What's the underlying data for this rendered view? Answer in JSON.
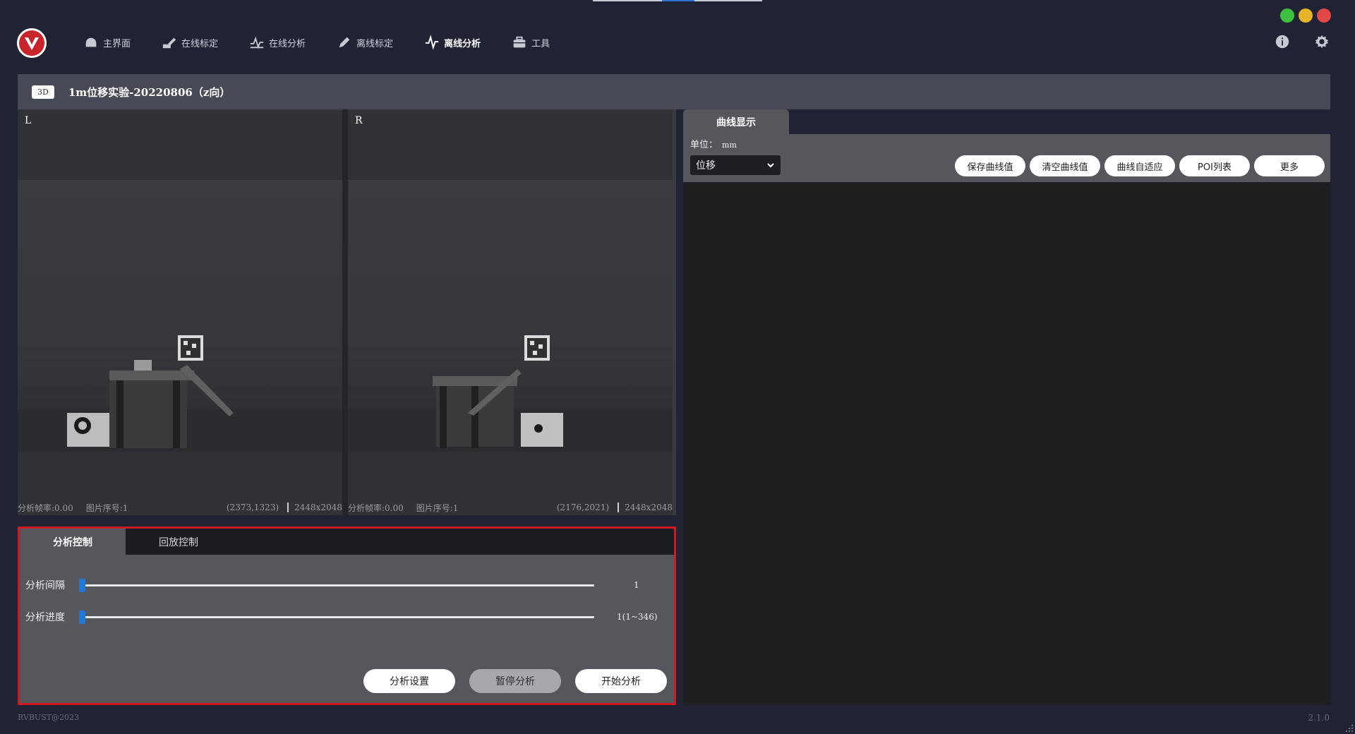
{
  "window": {
    "controls": [
      "green",
      "yellow",
      "red"
    ],
    "colors": {
      "green": "#3fbf3f",
      "yellow": "#e8b52a",
      "red": "#e04848"
    }
  },
  "nav": {
    "items": [
      {
        "label": "主界面",
        "icon": "home-icon"
      },
      {
        "label": "在线标定",
        "icon": "calibrate-pen-icon"
      },
      {
        "label": "在线分析",
        "icon": "analysis-icon"
      },
      {
        "label": "离线标定",
        "icon": "pen-icon"
      },
      {
        "label": "离线分析",
        "icon": "waveform-icon",
        "active": true
      },
      {
        "label": "工具",
        "icon": "toolbox-icon"
      }
    ],
    "right_icons": [
      "info-icon",
      "settings-icon"
    ]
  },
  "project": {
    "badge": "3D",
    "title": "1m位移实验-20220806（z向）"
  },
  "cameras": [
    {
      "label": "L",
      "fps_text": "分析帧率:0.00",
      "frame_text": "图片序号:1",
      "coord": "(2373,1323)",
      "resolution": "2448x2048"
    },
    {
      "label": "R",
      "fps_text": "分析帧率:0.00",
      "frame_text": "图片序号:1",
      "coord": "(2176,2021)",
      "resolution": "2448x2048"
    }
  ],
  "control": {
    "tabs": [
      {
        "label": "分析控制",
        "active": true
      },
      {
        "label": "回放控制",
        "active": false
      }
    ],
    "sliders": [
      {
        "label": "分析间隔",
        "value_text": "1",
        "level": 0
      },
      {
        "label": "分析进度",
        "value_text": "1(1~346)",
        "level": 0
      }
    ],
    "buttons": [
      {
        "label": "分析设置",
        "enabled": true
      },
      {
        "label": "暂停分析",
        "enabled": false
      },
      {
        "label": "开始分析",
        "enabled": true
      }
    ],
    "accent": "#d11a20"
  },
  "curve": {
    "tab": "曲线显示",
    "unit_label": "单位：",
    "unit_value": "mm",
    "select_value": "位移",
    "buttons": [
      "保存曲线值",
      "清空曲线值",
      "曲线自适应",
      "POI列表",
      "更多"
    ]
  },
  "footer": {
    "copyright": "RVBUST@2023",
    "version": "2.1.0"
  }
}
